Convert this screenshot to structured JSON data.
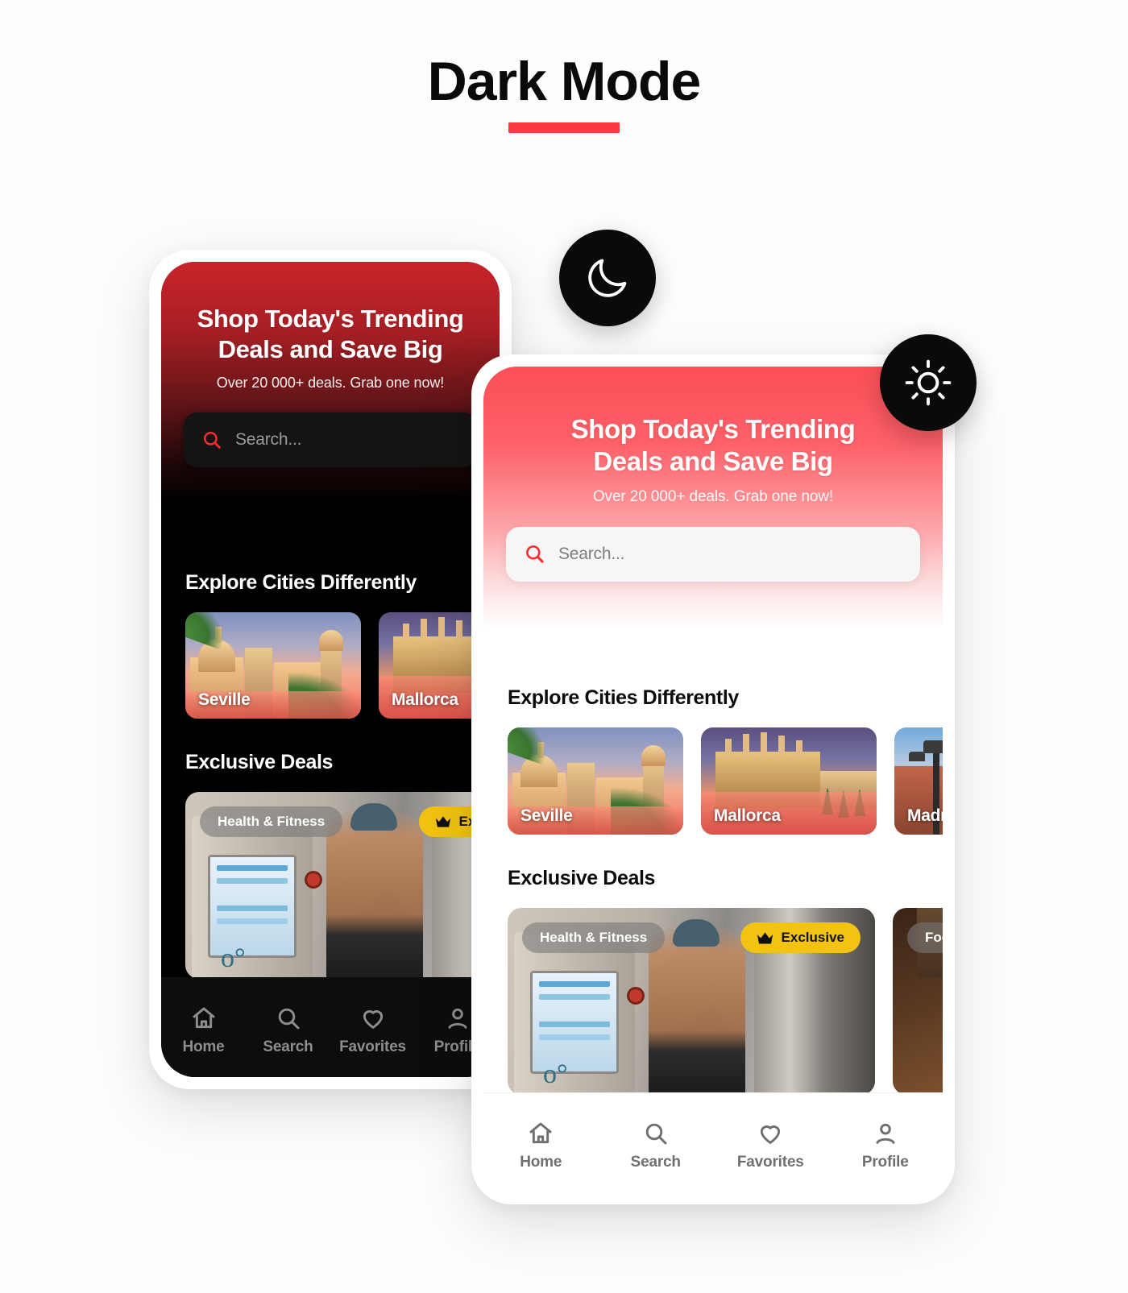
{
  "page": {
    "title": "Dark Mode",
    "accent_color": "#fb3a3f",
    "background": "#fdfdfd"
  },
  "toggles": [
    {
      "name": "moon-toggle",
      "icon": "moon-icon",
      "mode": "dark"
    },
    {
      "name": "sun-toggle",
      "icon": "sun-icon",
      "mode": "light"
    }
  ],
  "app": {
    "header": {
      "title": "Shop Today's Trending Deals and Save Big",
      "title_line1": "Shop Today's Trending",
      "title_line2": "Deals and Save Big",
      "subtitle": "Over 20 000+ deals. Grab one now!"
    },
    "search": {
      "placeholder": "Search...",
      "icon": "search-icon",
      "value": ""
    },
    "sections": [
      {
        "heading": "Explore Cities Differently",
        "cards": [
          {
            "name": "Seville"
          },
          {
            "name": "Mallorca"
          },
          {
            "name": "Madrid"
          }
        ]
      },
      {
        "heading": "Exclusive Deals",
        "cards": [
          {
            "tag": "Health & Fitness",
            "badge": "Exclusive",
            "badge_icon": "crown-icon",
            "badge_color": "#f2c310"
          },
          {
            "tag": "Food",
            "badge": "",
            "badge_icon": "",
            "badge_color": "#f2c310"
          }
        ]
      }
    ],
    "nav": {
      "items": [
        {
          "label": "Home",
          "icon": "home-icon",
          "active": true
        },
        {
          "label": "Search",
          "icon": "search-icon",
          "active": false
        },
        {
          "label": "Favorites",
          "icon": "heart-icon",
          "active": false
        },
        {
          "label": "Profile",
          "icon": "person-icon",
          "active": false
        }
      ],
      "active_color": "#fb2b30",
      "inactive_color_dark": "#8d8d8d",
      "inactive_color_light": "#6f6f6f"
    },
    "themes": {
      "dark": {
        "surface": "#000000",
        "header_gradient_from": "#c9242a",
        "header_gradient_to": "#000000",
        "search_bg": "#141414",
        "nav_bg": "#0d0d0d",
        "text": "#ffffff"
      },
      "light": {
        "surface": "#ffffff",
        "header_gradient_from": "#fc4f57",
        "header_gradient_to": "#ffffff",
        "search_bg": "#f7f6f7",
        "nav_bg": "#ffffff",
        "text": "#0b0b0b"
      }
    }
  }
}
